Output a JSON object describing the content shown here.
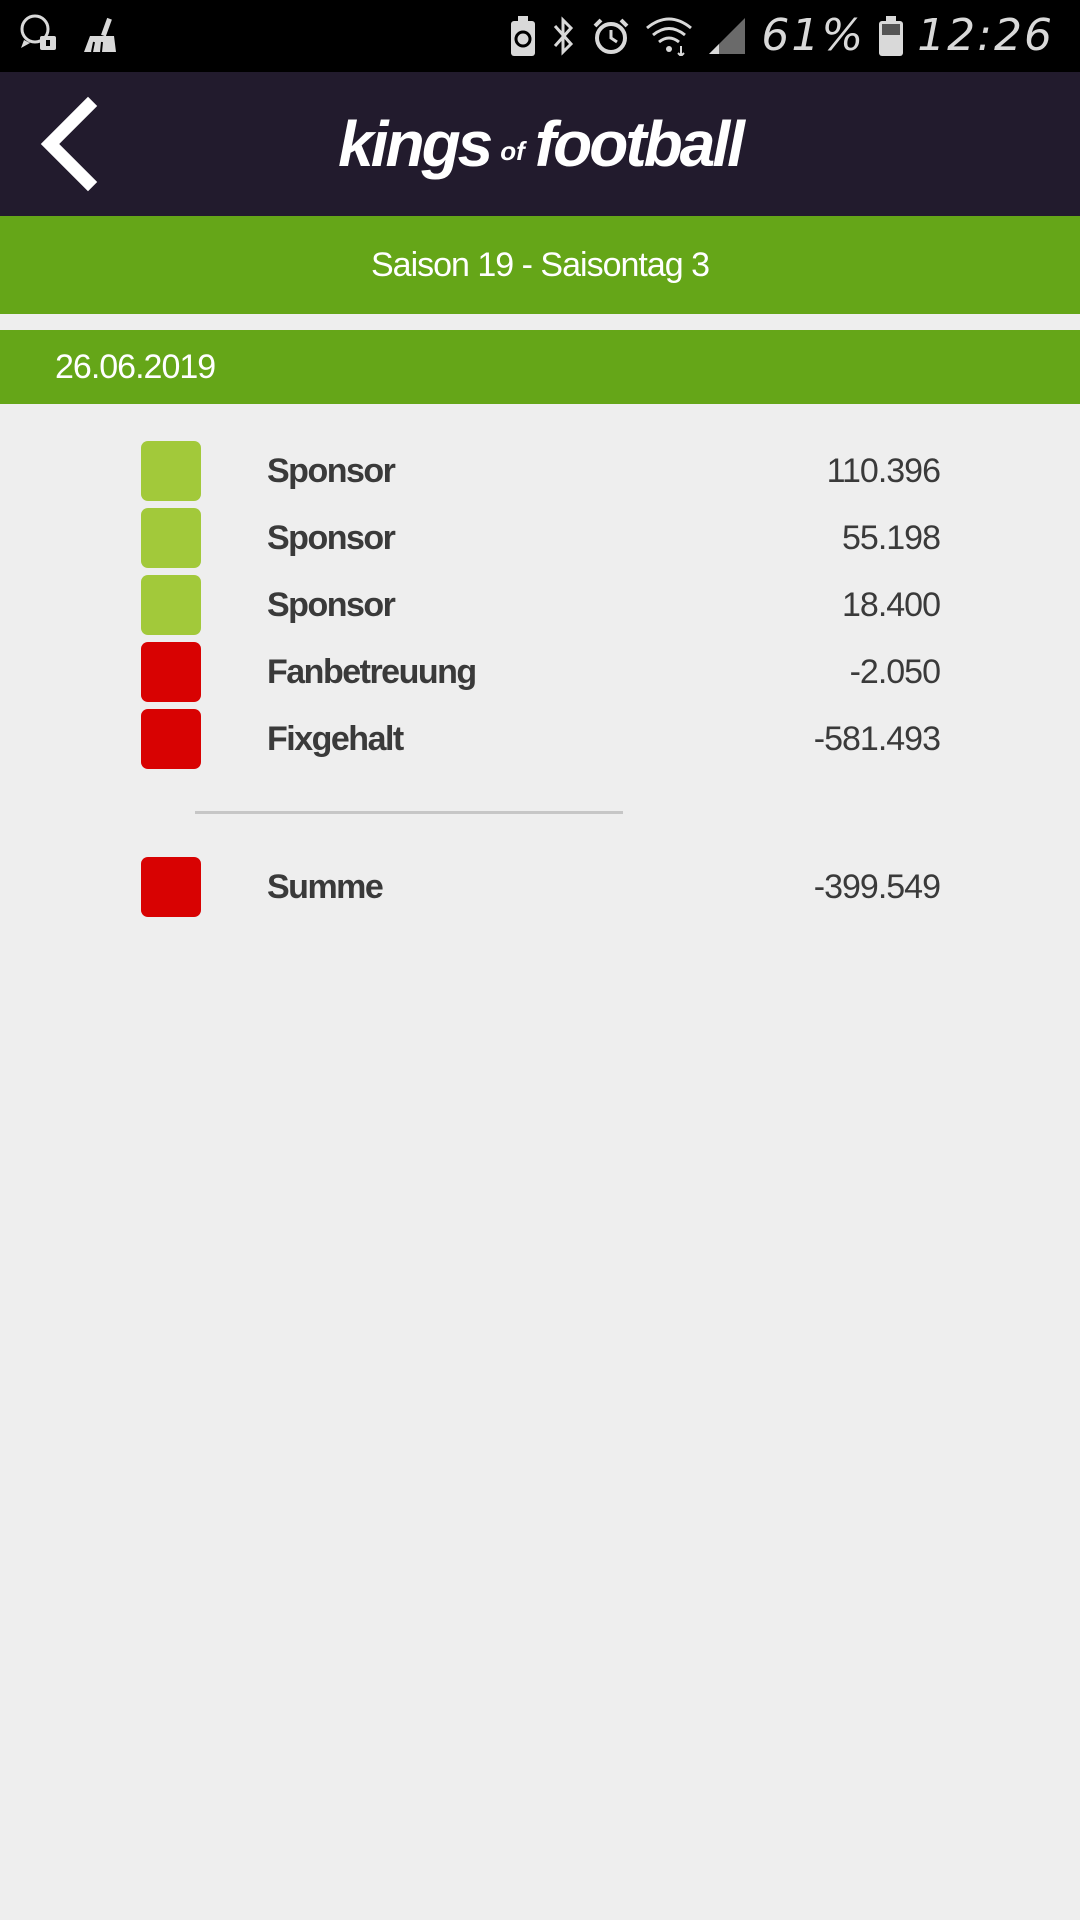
{
  "status_bar": {
    "battery": "61%",
    "time": "12:26",
    "icons": [
      "whatsapp-icon",
      "cleaner-icon",
      "battery-saver-icon",
      "bluetooth-icon",
      "alarm-icon",
      "wifi-icon",
      "signal-icon",
      "battery-icon"
    ]
  },
  "header": {
    "back_icon": "chevron-left-icon",
    "logo": {
      "part1": "kings",
      "part2": "of",
      "part3": "football"
    }
  },
  "season_title": "Saison 19 - Saisontag 3",
  "date": "26.06.2019",
  "colors": {
    "header_bg": "#221b2d",
    "green_bar": "#65a618",
    "positive": "#a2c93a",
    "negative": "#d80202"
  },
  "entries": [
    {
      "label": "Sponsor",
      "value": "110.396",
      "status": "positive"
    },
    {
      "label": "Sponsor",
      "value": "55.198",
      "status": "positive"
    },
    {
      "label": "Sponsor",
      "value": "18.400",
      "status": "positive"
    },
    {
      "label": "Fanbetreuung",
      "value": "-2.050",
      "status": "negative"
    },
    {
      "label": "Fixgehalt",
      "value": "-581.493",
      "status": "negative"
    }
  ],
  "sum": {
    "label": "Summe",
    "value": "-399.549",
    "status": "negative"
  }
}
